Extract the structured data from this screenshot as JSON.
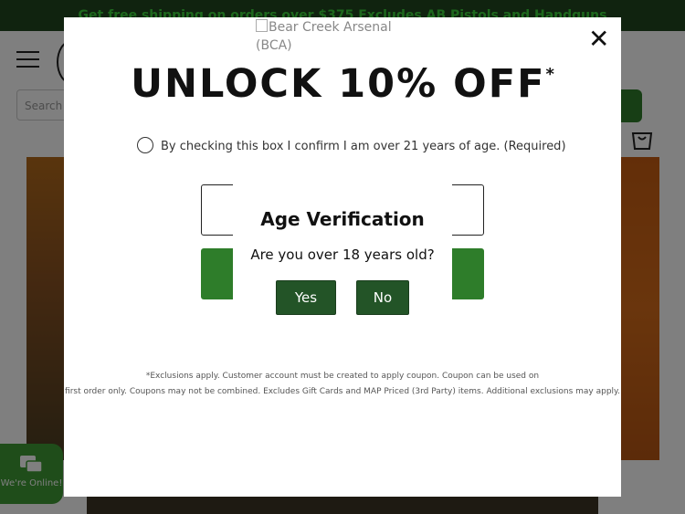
{
  "promo_bar": {
    "text": "Get free shipping on orders over $375 Excludes AB Pistols and Handguns"
  },
  "search": {
    "placeholder": "Search"
  },
  "chat": {
    "label": "We're Online!"
  },
  "promo_modal": {
    "logo_alt": "Bear Creek Arsenal (BCA)",
    "close_glyph": "✕",
    "headline": "UNLOCK 10% OFF",
    "headline_mark": "*",
    "age_checkbox_label": "By checking this box I confirm I am over 21 years of age. (Required)",
    "disclaimer_line1": "*Exclusions apply. Customer account must be created to apply coupon. Coupon can be used on",
    "disclaimer_line2": "first order only. Coupons may not be combined. Excludes Gift Cards and MAP Priced (3rd Party) items. Additional exclusions may apply."
  },
  "age_dialog": {
    "title": "Age Verification",
    "question": "Are you over 18 years old?",
    "yes_label": "Yes",
    "no_label": "No"
  },
  "colors": {
    "brand_green": "#2e7d2a",
    "dark_green": "#235427",
    "promo_bar_bg": "#20471f",
    "promo_bar_text": "#3bd13a"
  }
}
